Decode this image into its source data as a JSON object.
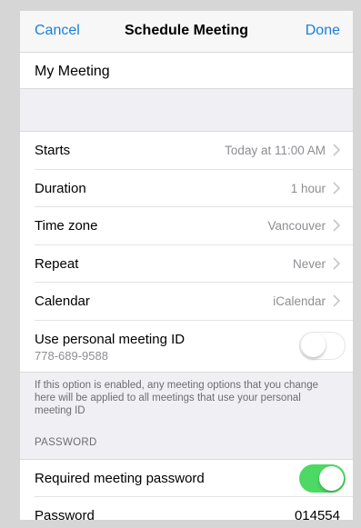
{
  "navbar": {
    "cancel_label": "Cancel",
    "title": "Schedule Meeting",
    "done_label": "Done"
  },
  "topic": {
    "value": "My Meeting"
  },
  "settings": {
    "starts": {
      "label": "Starts",
      "value": "Today at 11:00 AM"
    },
    "duration": {
      "label": "Duration",
      "value": "1 hour"
    },
    "timezone": {
      "label": "Time zone",
      "value": "Vancouver"
    },
    "repeat": {
      "label": "Repeat",
      "value": "Never"
    },
    "calendar": {
      "label": "Calendar",
      "value": "iCalendar"
    },
    "pmi": {
      "label": "Use personal meeting ID",
      "id": "778-689-9588",
      "enabled": false
    }
  },
  "pmi_note": "If this option is enabled, any meeting options that you change here will be applied to all meetings that use your personal meeting ID",
  "password_section": {
    "header": "PASSWORD",
    "required": {
      "label": "Required meeting password",
      "enabled": true
    },
    "password": {
      "label": "Password",
      "value": "014554"
    }
  },
  "colors": {
    "accent": "#1a7fd8",
    "toggle_on": "#4cd964",
    "secondary_text": "#8e8e93",
    "background": "#efeff4"
  },
  "icons": {
    "chevron": "chevron-right-icon"
  }
}
